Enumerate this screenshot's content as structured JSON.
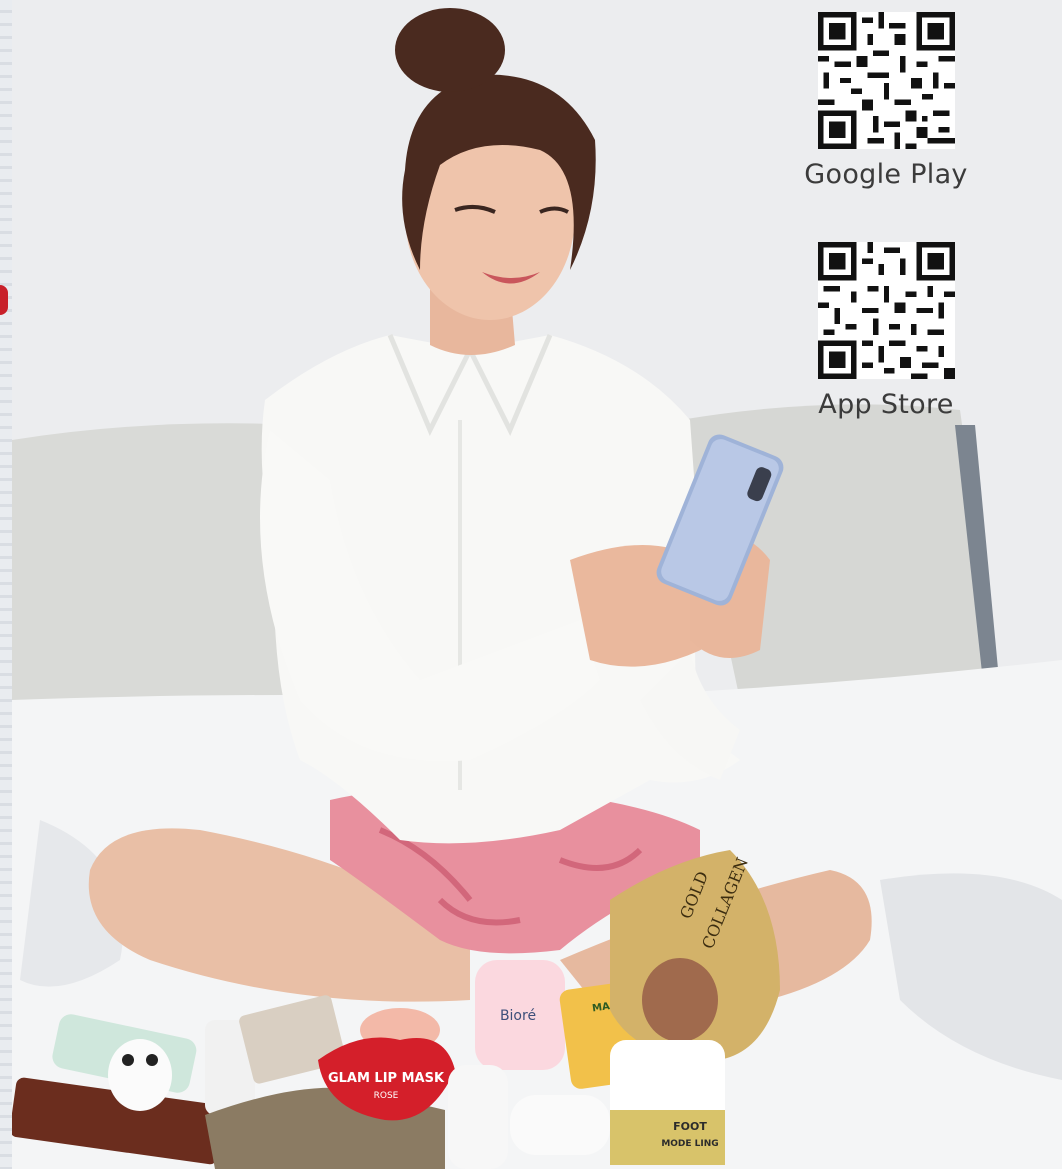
{
  "downloads": {
    "google_play": {
      "label": "Google Play",
      "icon": "qr-code-icon"
    },
    "app_store": {
      "label": "App Store",
      "icon": "qr-code-icon"
    }
  },
  "photo": {
    "products": {
      "lip_mask": "GLAM LIP MASK",
      "lip_mask_sub": "ROSE",
      "cleanser_brand": "Bioré",
      "collagen_line1": "GOLD",
      "collagen_line2": "COLLAGEN",
      "mango": "MANGO",
      "foot": "FOOT",
      "modeling": "MODE LING"
    }
  },
  "colors": {
    "wall": "#ecedef",
    "label": "#3b3b3b",
    "lip_mask": "#d41f2a",
    "shorts": "#e8909e"
  }
}
